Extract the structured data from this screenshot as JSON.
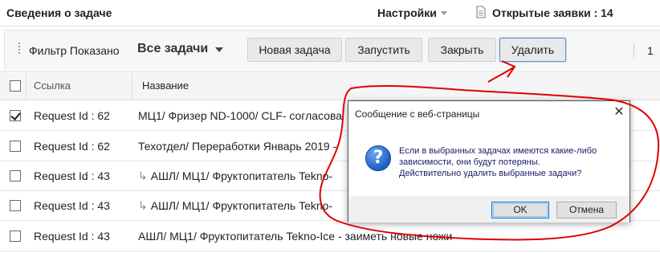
{
  "header": {
    "title": "Сведения о задаче",
    "settings_label": "Настройки",
    "open_requests_label": "Открытые заявки : 14"
  },
  "toolbar": {
    "filter_label": "Фильтр Показано",
    "view_selected": "Все задачи",
    "new_task_label": "Новая задача",
    "start_label": "Запустить",
    "close_label": "Закрыть",
    "delete_label": "Удалить",
    "page_indicator": "1"
  },
  "table": {
    "columns": {
      "link": "Ссылка",
      "name": "Название"
    },
    "rows": [
      {
        "id": "Request Id : 62",
        "subtask_marker": "",
        "name": "МЦ1/ Фризер ND-1000/ CLF- согласова",
        "checked": true
      },
      {
        "id": "Request Id : 62",
        "subtask_marker": "",
        "name": "Техотдел/ Переработки Январь 2019 -",
        "checked": false
      },
      {
        "id": "Request Id : 43",
        "subtask_marker": "↳",
        "name": "АШЛ/ МЦ1/ Фруктопитатель Tekno-",
        "checked": false
      },
      {
        "id": "Request Id : 43",
        "subtask_marker": "↳",
        "name": "АШЛ/ МЦ1/ Фруктопитатель Tekno-",
        "checked": false
      },
      {
        "id": "Request Id : 43",
        "subtask_marker": "",
        "name": "АШЛ/ МЦ1/ Фруктопитатель Tekno-Ice - заиметь новые ножи",
        "checked": false
      }
    ]
  },
  "dialog": {
    "title": "Сообщение с веб-страницы",
    "message_line1": "Если в выбранных задачах имеются какие-либо",
    "message_line2": "зависимости, они будут потеряны.",
    "message_line3": "Действительно удалить выбранные задачи?",
    "ok_label": "OK",
    "cancel_label": "Отмена",
    "close_glyph": "✕",
    "icon": "question-icon",
    "icon_glyph": "?"
  },
  "colors": {
    "annotation_red": "#e00000",
    "dialog_text": "#1a1a66",
    "delete_border": "#6c8fc6"
  }
}
